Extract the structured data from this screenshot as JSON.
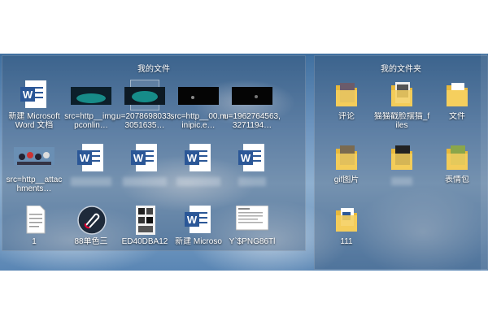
{
  "fences": {
    "left": {
      "title": "我的文件",
      "items": [
        {
          "label": "新建 Microsoft Word 文档",
          "icon": "word-doc-icon"
        },
        {
          "label": "src=http__img.pconlin…",
          "icon": "image-thumbnail-icon"
        },
        {
          "label": "u=2078698033,3051635…",
          "icon": "image-thumbnail-icon"
        },
        {
          "label": "src=http__00.minipic.e…",
          "icon": "image-thumbnail-icon"
        },
        {
          "label": "u=1962764563,3271194…",
          "icon": "image-thumbnail-icon"
        },
        {
          "label": "src=http__attachments…",
          "icon": "image-thumbnail-icon"
        },
        {
          "label": "",
          "icon": "word-doc-icon"
        },
        {
          "label": "",
          "icon": "word-doc-icon"
        },
        {
          "label": "",
          "icon": "word-doc-icon"
        },
        {
          "label": "",
          "icon": "word-doc-icon"
        },
        {
          "label": "1",
          "icon": "text-file-icon"
        },
        {
          "label": "88单色三",
          "icon": "paperclip-app-icon"
        },
        {
          "label": "ED40DBA12",
          "icon": "image-thumbnail-icon"
        },
        {
          "label": "新建 Microso",
          "icon": "word-doc-icon"
        },
        {
          "label": "Y`$PNG86Tl",
          "icon": "image-thumbnail-icon"
        }
      ]
    },
    "right": {
      "title": "我的文件夹",
      "items": [
        {
          "label": "评论",
          "icon": "folder-icon"
        },
        {
          "label": "猫猫戳脸摆猫_files",
          "icon": "folder-icon"
        },
        {
          "label": "文件",
          "icon": "folder-icon"
        },
        {
          "label": "gif图片",
          "icon": "folder-icon"
        },
        {
          "label": "",
          "icon": "folder-icon"
        },
        {
          "label": "表情包",
          "icon": "folder-icon"
        },
        {
          "label": "111",
          "icon": "folder-icon"
        }
      ]
    }
  },
  "colors": {
    "word_blue": "#2b5797",
    "folder_yellow": "#f2c94c"
  }
}
